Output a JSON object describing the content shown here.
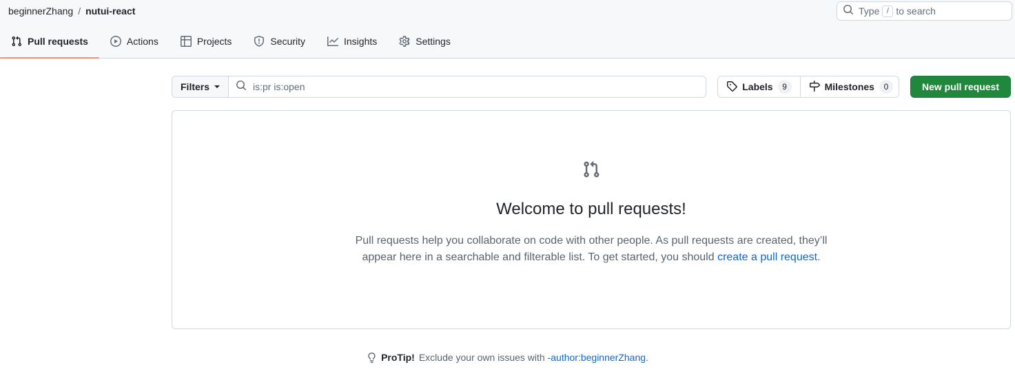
{
  "header": {
    "breadcrumb": {
      "owner": "beginnerZhang",
      "separator": "/",
      "repo": "nutui-react"
    },
    "search": {
      "placeholder_prefix": "Type",
      "kbd": "/",
      "placeholder_suffix": "to search",
      "icon": "search-icon"
    }
  },
  "nav": {
    "tabs": [
      {
        "label": "Pull requests",
        "icon": "git-pull-request-icon",
        "active": true
      },
      {
        "label": "Actions",
        "icon": "play-circle-icon",
        "active": false
      },
      {
        "label": "Projects",
        "icon": "table-icon",
        "active": false
      },
      {
        "label": "Security",
        "icon": "shield-icon",
        "active": false
      },
      {
        "label": "Insights",
        "icon": "graph-icon",
        "active": false
      },
      {
        "label": "Settings",
        "icon": "gear-icon",
        "active": false
      }
    ],
    "active_underline_color": "#fd8c73"
  },
  "filterbar": {
    "filters_label": "Filters",
    "search_value": "is:pr is:open",
    "labels": {
      "label": "Labels",
      "count": "9",
      "icon": "tag-icon"
    },
    "milestones": {
      "label": "Milestones",
      "count": "0",
      "icon": "milestone-icon"
    },
    "new_pull_request": "New pull request",
    "new_pr_color": "#1f883d"
  },
  "empty_state": {
    "icon": "git-pull-request-icon",
    "title": "Welcome to pull requests!",
    "body_part1": "Pull requests help you collaborate on code with other people. As pull requests are created, they’ll appear here in a searchable and filterable list. To get started, you should ",
    "body_link": "create a pull request",
    "body_part2": "."
  },
  "protip": {
    "icon": "lightbulb-icon",
    "label": "ProTip!",
    "text": "Exclude your own issues with ",
    "link": "-author:beginnerZhang",
    "suffix": "."
  }
}
